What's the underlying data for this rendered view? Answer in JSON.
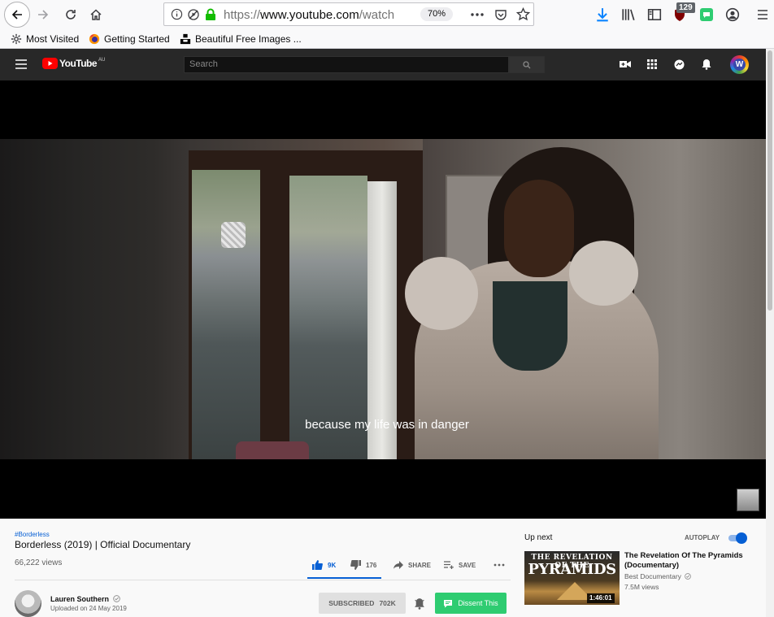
{
  "browser": {
    "url": "https://www.youtube.com/watch?",
    "url_protocol": "https://",
    "url_host": "www.youtube.com",
    "url_path": "/watch?",
    "zoom": "70%",
    "extension_badge": "129",
    "bookmarks": [
      {
        "label": "Most Visited",
        "icon": "gear-icon"
      },
      {
        "label": "Getting Started",
        "icon": "firefox-icon"
      },
      {
        "label": "Beautiful Free Images ...",
        "icon": "unsplash-icon"
      }
    ]
  },
  "youtube": {
    "logo_text": "YouTube",
    "logo_country": "AU",
    "search_placeholder": "Search"
  },
  "player": {
    "subtitle": "because my life was in danger"
  },
  "video": {
    "hashtag": "#Borderless",
    "title": "Borderless (2019) | Official Documentary",
    "views": "66,222 views",
    "likes": "9K",
    "dislikes": "176",
    "share_label": "SHARE",
    "save_label": "SAVE"
  },
  "channel": {
    "name": "Lauren Southern",
    "upload_date": "Uploaded on 24 May 2019",
    "subscribed_label": "SUBSCRIBED",
    "subscriber_count": "702K",
    "dissent_label": "Dissent This"
  },
  "sidebar": {
    "up_next_label": "Up next",
    "autoplay_label": "AUTOPLAY",
    "autoplay_on": true,
    "recommendations": [
      {
        "thumb_line1": "THE REVELATION OF THE",
        "thumb_line2": "PYRAMIDS",
        "title": "The Revelation Of The Pyramids (Documentary)",
        "channel": "Best Documentary",
        "views": "7.5M views",
        "duration": "1:46:01"
      }
    ]
  },
  "colors": {
    "yt_red": "#ff0000",
    "yt_blue": "#065fd4",
    "dissent_green": "#2ecc71",
    "masthead": "#282828"
  }
}
